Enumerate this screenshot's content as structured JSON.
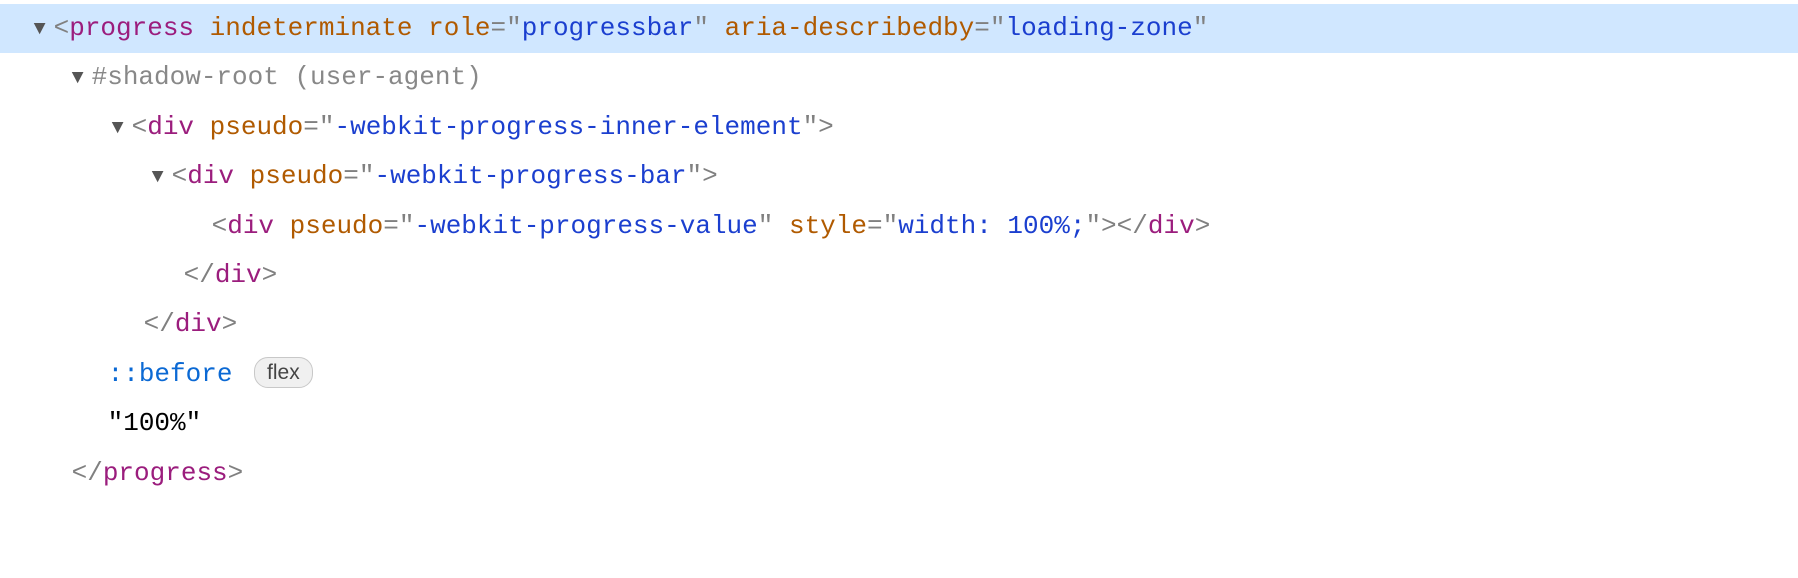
{
  "line0": {
    "tag": "progress",
    "attr1_name": "indeterminate",
    "attr2_name": "role",
    "attr2_value": "progressbar",
    "attr3_name": "aria-describedby",
    "attr3_value": "loading-zone"
  },
  "line1": {
    "text": "#shadow-root (user-agent)"
  },
  "line2": {
    "tag": "div",
    "attr1_name": "pseudo",
    "attr1_value": "-webkit-progress-inner-element"
  },
  "line3": {
    "tag": "div",
    "attr1_name": "pseudo",
    "attr1_value": "-webkit-progress-bar"
  },
  "line4": {
    "tag": "div",
    "attr1_name": "pseudo",
    "attr1_value": "-webkit-progress-value",
    "attr2_name": "style",
    "attr2_value": "width: 100%;",
    "closetag": "div"
  },
  "line5": {
    "closetag": "div"
  },
  "line6": {
    "closetag": "div"
  },
  "line7": {
    "pseudo": "::before",
    "pill": "flex"
  },
  "line8": {
    "text": "\"100%\""
  },
  "line9": {
    "closetag": "progress"
  }
}
